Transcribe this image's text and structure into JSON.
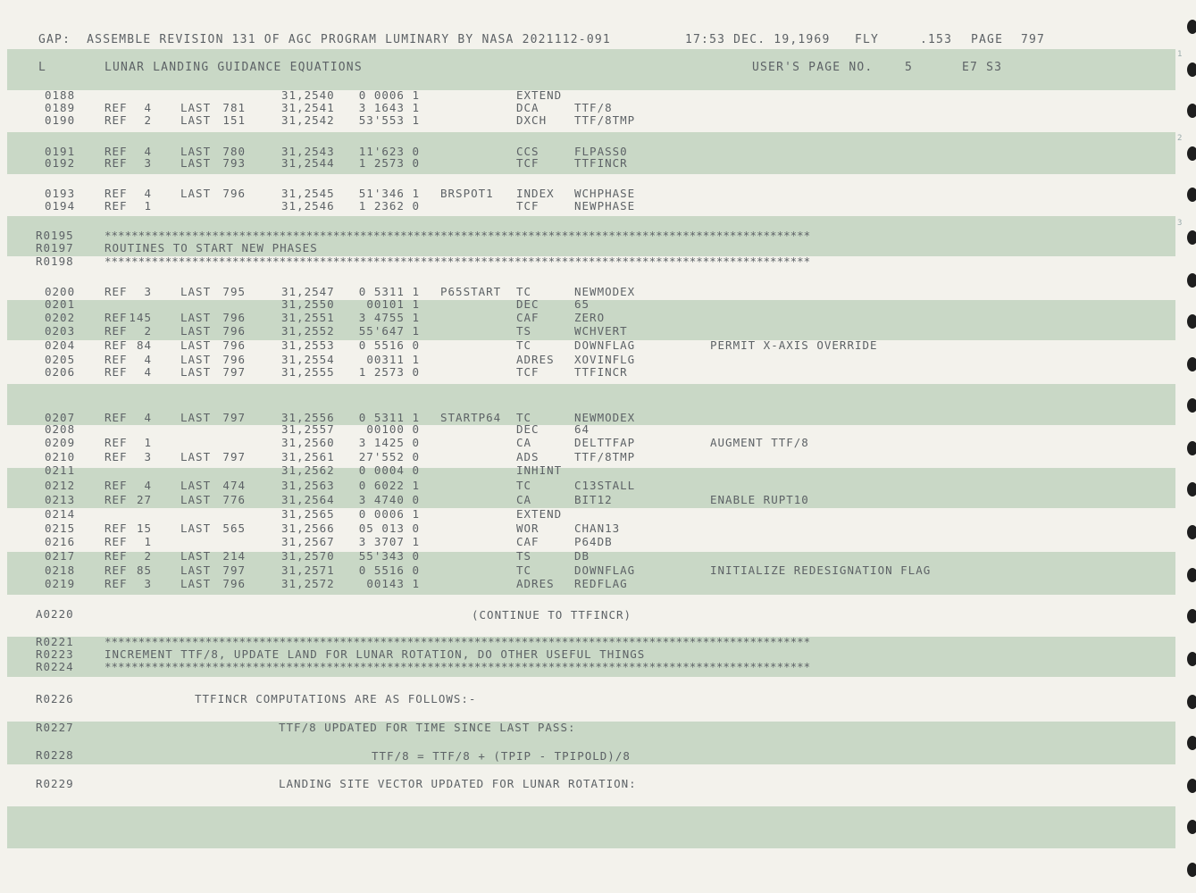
{
  "header": {
    "left": "GAP:  ASSEMBLE REVISION 131 OF AGC PROGRAM LUMINARY BY NASA 2021112-091",
    "datetime": "17:53 DEC. 19,1969",
    "fly": "FLY",
    "seq": ".153",
    "page_label": "PAGE",
    "page_num": "797"
  },
  "subheader": {
    "log": "L",
    "section": "LUNAR LANDING GUIDANCE EQUATIONS",
    "users_page_label": "USER'S PAGE NO.",
    "users_page_num": "5",
    "code": "E7 S3"
  },
  "listing": [
    {
      "rn": "0188",
      "ref": "",
      "r1": "",
      "last": "",
      "r2": "",
      "addr": "31,2540",
      "code": "0 0006 1",
      "lbl": "",
      "op": "EXTEND",
      "opd": "",
      "cmt": ""
    },
    {
      "rn": "0189",
      "ref": "REF",
      "r1": "4",
      "last": "LAST",
      "r2": "781",
      "addr": "31,2541",
      "code": "3 1643 1",
      "lbl": "",
      "op": "DCA",
      "opd": "TTF/8",
      "cmt": ""
    },
    {
      "rn": "0190",
      "ref": "REF",
      "r1": "2",
      "last": "LAST",
      "r2": "151",
      "addr": "31,2542",
      "code": "53'553 1",
      "lbl": "",
      "op": "DXCH",
      "opd": "TTF/8TMP",
      "cmt": ""
    },
    {
      "rn": "0191",
      "ref": "REF",
      "r1": "4",
      "last": "LAST",
      "r2": "780",
      "addr": "31,2543",
      "code": "11'623 0",
      "lbl": "",
      "op": "CCS",
      "opd": "FLPASS0",
      "cmt": ""
    },
    {
      "rn": "0192",
      "ref": "REF",
      "r1": "3",
      "last": "LAST",
      "r2": "793",
      "addr": "31,2544",
      "code": "1 2573 0",
      "lbl": "",
      "op": "TCF",
      "opd": "TTFINCR",
      "cmt": ""
    },
    {
      "rn": "0193",
      "ref": "REF",
      "r1": "4",
      "last": "LAST",
      "r2": "796",
      "addr": "31,2545",
      "code": "51'346 1",
      "lbl": "BRSPOT1",
      "op": "INDEX",
      "opd": "WCHPHASE",
      "cmt": ""
    },
    {
      "rn": "0194",
      "ref": "REF",
      "r1": "1",
      "last": "",
      "r2": "",
      "addr": "31,2546",
      "code": "1 2362 0",
      "lbl": "",
      "op": "TCF",
      "opd": "NEWPHASE",
      "cmt": ""
    },
    {
      "rn": "0200",
      "ref": "REF",
      "r1": "3",
      "last": "LAST",
      "r2": "795",
      "addr": "31,2547",
      "code": "0 5311 1",
      "lbl": "P65START",
      "op": "TC",
      "opd": "NEWMODEX",
      "cmt": ""
    },
    {
      "rn": "0201",
      "ref": "",
      "r1": "",
      "last": "",
      "r2": "",
      "addr": "31,2550",
      "code": "00101 1",
      "lbl": "",
      "op": "DEC",
      "opd": "65",
      "cmt": ""
    },
    {
      "rn": "0202",
      "ref": "REF",
      "r1": "145",
      "last": "LAST",
      "r2": "796",
      "addr": "31,2551",
      "code": "3 4755 1",
      "lbl": "",
      "op": "CAF",
      "opd": "ZERO",
      "cmt": ""
    },
    {
      "rn": "0203",
      "ref": "REF",
      "r1": "2",
      "last": "LAST",
      "r2": "796",
      "addr": "31,2552",
      "code": "55'647 1",
      "lbl": "",
      "op": "TS",
      "opd": "WCHVERT",
      "cmt": ""
    },
    {
      "rn": "0204",
      "ref": "REF",
      "r1": "84",
      "last": "LAST",
      "r2": "796",
      "addr": "31,2553",
      "code": "0 5516 0",
      "lbl": "",
      "op": "TC",
      "opd": "DOWNFLAG",
      "cmt": "PERMIT X-AXIS OVERRIDE"
    },
    {
      "rn": "0205",
      "ref": "REF",
      "r1": "4",
      "last": "LAST",
      "r2": "796",
      "addr": "31,2554",
      "code": "00311 1",
      "lbl": "",
      "op": "ADRES",
      "opd": "XOVINFLG",
      "cmt": ""
    },
    {
      "rn": "0206",
      "ref": "REF",
      "r1": "4",
      "last": "LAST",
      "r2": "797",
      "addr": "31,2555",
      "code": "1 2573 0",
      "lbl": "",
      "op": "TCF",
      "opd": "TTFINCR",
      "cmt": ""
    },
    {
      "rn": "0207",
      "ref": "REF",
      "r1": "4",
      "last": "LAST",
      "r2": "797",
      "addr": "31,2556",
      "code": "0 5311 1",
      "lbl": "STARTP64",
      "op": "TC",
      "opd": "NEWMODEX",
      "cmt": ""
    },
    {
      "rn": "0208",
      "ref": "",
      "r1": "",
      "last": "",
      "r2": "",
      "addr": "31,2557",
      "code": "00100 0",
      "lbl": "",
      "op": "DEC",
      "opd": "64",
      "cmt": ""
    },
    {
      "rn": "0209",
      "ref": "REF",
      "r1": "1",
      "last": "",
      "r2": "",
      "addr": "31,2560",
      "code": "3 1425 0",
      "lbl": "",
      "op": "CA",
      "opd": "DELTTFAP",
      "cmt": "AUGMENT TTF/8"
    },
    {
      "rn": "0210",
      "ref": "REF",
      "r1": "3",
      "last": "LAST",
      "r2": "797",
      "addr": "31,2561",
      "code": "27'552 0",
      "lbl": "",
      "op": "ADS",
      "opd": "TTF/8TMP",
      "cmt": ""
    },
    {
      "rn": "0211",
      "ref": "",
      "r1": "",
      "last": "",
      "r2": "",
      "addr": "31,2562",
      "code": "0 0004 0",
      "lbl": "",
      "op": "INHINT",
      "opd": "",
      "cmt": ""
    },
    {
      "rn": "0212",
      "ref": "REF",
      "r1": "4",
      "last": "LAST",
      "r2": "474",
      "addr": "31,2563",
      "code": "0 6022 1",
      "lbl": "",
      "op": "TC",
      "opd": "C13STALL",
      "cmt": ""
    },
    {
      "rn": "0213",
      "ref": "REF",
      "r1": "27",
      "last": "LAST",
      "r2": "776",
      "addr": "31,2564",
      "code": "3 4740 0",
      "lbl": "",
      "op": "CA",
      "opd": "BIT12",
      "cmt": "ENABLE RUPT10"
    },
    {
      "rn": "0214",
      "ref": "",
      "r1": "",
      "last": "",
      "r2": "",
      "addr": "31,2565",
      "code": "0 0006 1",
      "lbl": "",
      "op": "EXTEND",
      "opd": "",
      "cmt": ""
    },
    {
      "rn": "0215",
      "ref": "REF",
      "r1": "15",
      "last": "LAST",
      "r2": "565",
      "addr": "31,2566",
      "code": "05 013 0",
      "lbl": "",
      "op": "WOR",
      "opd": "CHAN13",
      "cmt": ""
    },
    {
      "rn": "0216",
      "ref": "REF",
      "r1": "1",
      "last": "",
      "r2": "",
      "addr": "31,2567",
      "code": "3 3707 1",
      "lbl": "",
      "op": "CAF",
      "opd": "P64DB",
      "cmt": ""
    },
    {
      "rn": "0217",
      "ref": "REF",
      "r1": "2",
      "last": "LAST",
      "r2": "214",
      "addr": "31,2570",
      "code": "55'343 0",
      "lbl": "",
      "op": "TS",
      "opd": "DB",
      "cmt": ""
    },
    {
      "rn": "0218",
      "ref": "REF",
      "r1": "85",
      "last": "LAST",
      "r2": "797",
      "addr": "31,2571",
      "code": "0 5516 0",
      "lbl": "",
      "op": "TC",
      "opd": "DOWNFLAG",
      "cmt": "INITIALIZE REDESIGNATION FLAG"
    },
    {
      "rn": "0219",
      "ref": "REF",
      "r1": "3",
      "last": "LAST",
      "r2": "796",
      "addr": "31,2572",
      "code": "00143 1",
      "lbl": "",
      "op": "ADRES",
      "opd": "REDFLAG",
      "cmt": ""
    }
  ],
  "remarks": [
    {
      "rn": "R0195",
      "text": "*********************************************************************************************************"
    },
    {
      "rn": "R0197",
      "text": "ROUTINES TO START NEW PHASES"
    },
    {
      "rn": "R0198",
      "text": "*********************************************************************************************************"
    },
    {
      "rn": "A0220",
      "text": "(CONTINUE TO TTFINCR)"
    },
    {
      "rn": "R0221",
      "text": "*********************************************************************************************************"
    },
    {
      "rn": "R0223",
      "text": "INCREMENT TTF/8, UPDATE LAND FOR LUNAR ROTATION, DO OTHER USEFUL THINGS"
    },
    {
      "rn": "R0224",
      "text": "*********************************************************************************************************"
    },
    {
      "rn": "R0226",
      "text": "TTFINCR COMPUTATIONS ARE AS FOLLOWS:-"
    },
    {
      "rn": "R0227",
      "text": "TTF/8 UPDATED FOR TIME SINCE LAST PASS:"
    },
    {
      "rn": "R0228",
      "text": "TTF/8 = TTF/8 + (TPIP - TPIPOLD)/8"
    },
    {
      "rn": "R0229",
      "text": "LANDING SITE VECTOR UPDATED FOR LUNAR ROTATION:"
    }
  ],
  "margin_marks": {
    "m1": "1",
    "m2": "2",
    "m3": "3"
  }
}
